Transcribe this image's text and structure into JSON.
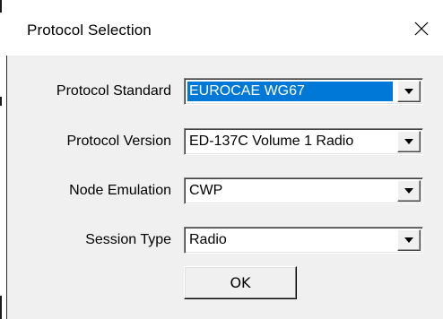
{
  "window": {
    "title": "Protocol Selection",
    "close_icon": "close-icon"
  },
  "form": {
    "rows": [
      {
        "label": "Protocol Standard",
        "value": "EUROCAE WG67",
        "selected": true
      },
      {
        "label": "Protocol Version",
        "value": "ED-137C Volume 1 Radio",
        "selected": false
      },
      {
        "label": "Node Emulation",
        "value": "CWP",
        "selected": false
      },
      {
        "label": "Session Type",
        "value": "Radio",
        "selected": false
      }
    ],
    "ok_label": "OK"
  },
  "colors": {
    "selection_bg": "#0078d7",
    "dialog_bg": "#f0f0f0",
    "titlebar_bg": "#ffffff"
  }
}
